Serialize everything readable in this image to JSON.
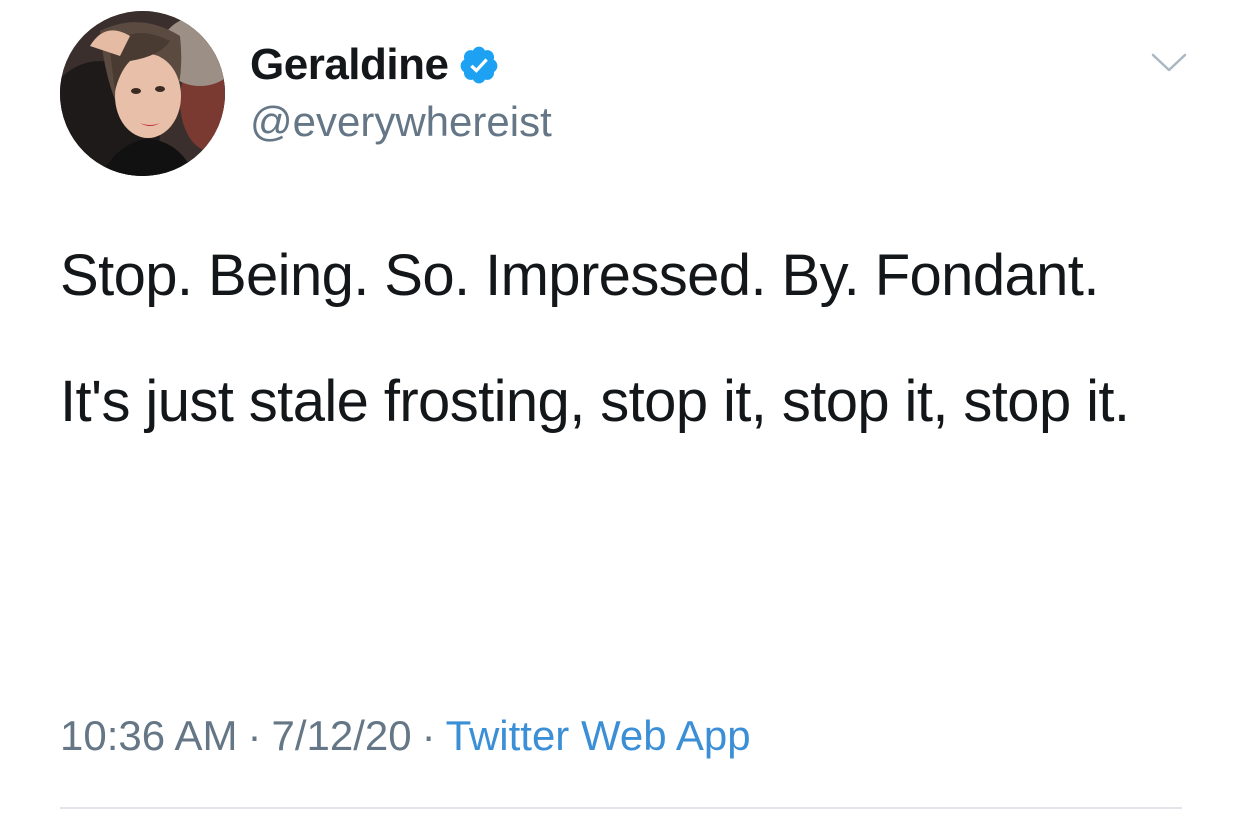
{
  "author": {
    "display_name": "Geraldine",
    "handle": "@everywhereist",
    "verified": true,
    "verified_color": "#1da1f2",
    "avatar_icon": "profile-photo"
  },
  "menu_icon": "chevron-down-icon",
  "tweet": {
    "paragraph_1": "Stop. Being. So. Impressed. By. Fondant.",
    "paragraph_2": "It's just stale frosting, stop it, stop it, stop it."
  },
  "meta": {
    "time": "10:36 AM",
    "separator": "·",
    "date": "7/12/20",
    "source": "Twitter Web App",
    "source_color": "#3b8fd6"
  }
}
